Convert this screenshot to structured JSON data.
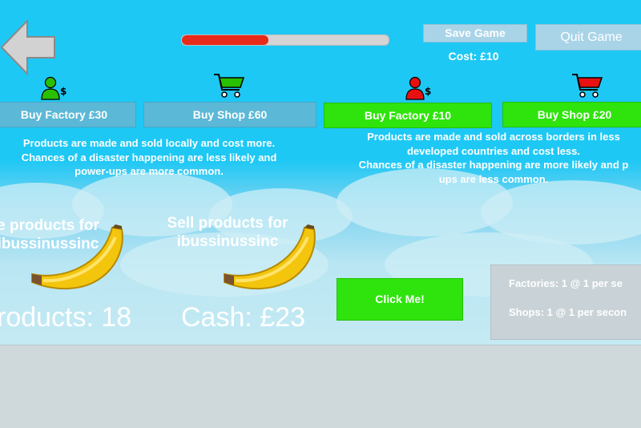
{
  "header": {
    "progress_fraction": 0.42,
    "save_label": "Save Game",
    "quit_label": "Quit Game",
    "cost_label": "Cost: £10"
  },
  "local": {
    "buy_factory_label": "Buy Factory £30",
    "buy_shop_label": "Buy Shop £60",
    "description": [
      "Products are made and sold locally and cost more.",
      "Chances of a disaster happening are less likely and",
      "power-ups are more common."
    ]
  },
  "global": {
    "buy_factory_label": "Buy Factory £10",
    "buy_shop_label": "Buy Shop £20",
    "description": [
      "Products are made and sold across borders in less",
      "developed countries and cost less.",
      "Chances of a disaster happening are more likely and p",
      "ups are less common."
    ]
  },
  "sell_left": {
    "line1": "e products for",
    "line2": "ibussinussinc"
  },
  "sell_right": {
    "line1": "Sell products for",
    "line2": "ibussinussinc"
  },
  "stats": {
    "products": "roducts: 18",
    "cash": "Cash: £23"
  },
  "click_label": "Click Me!",
  "panel": {
    "factories": "Factories: 1 @ 1 per se",
    "shops": "Shops: 1 @ 1 per secon"
  },
  "colors": {
    "sky": "#1ec8f5",
    "button_green": "#2ee40c",
    "button_blue": "#5bb8d6",
    "progress_red": "#e82a1a",
    "icon_green": "#28c000",
    "icon_red": "#e81010"
  },
  "icons": [
    "back-arrow-icon",
    "green-person-money-icon",
    "green-cart-icon",
    "red-person-money-icon",
    "red-cart-icon",
    "banana-icon"
  ]
}
